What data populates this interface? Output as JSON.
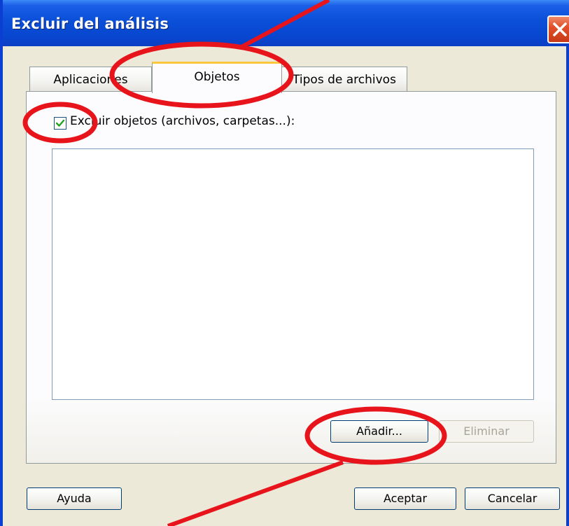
{
  "window": {
    "title": "Excluir del análisis"
  },
  "tabs": [
    {
      "label": "Aplicaciones"
    },
    {
      "label": "Objetos",
      "active": true
    },
    {
      "label": "Tipos de archivos"
    }
  ],
  "exclude_objects": {
    "checked": true,
    "label": "Excluir objetos (archivos, carpetas...):"
  },
  "list": {
    "items": []
  },
  "buttons": {
    "add": "Añadir...",
    "remove": "Eliminar",
    "help": "Ayuda",
    "ok": "Aceptar",
    "cancel": "Cancelar"
  },
  "colors": {
    "title_bar": "#0846cf",
    "dialog_background": "#ece9d8",
    "close_button": "#e0502a",
    "active_tab_highlight": "#ffc83c",
    "annotation_red": "#e8141c"
  },
  "icons": {
    "close": "close-icon",
    "checkmark": "checkmark-icon"
  }
}
